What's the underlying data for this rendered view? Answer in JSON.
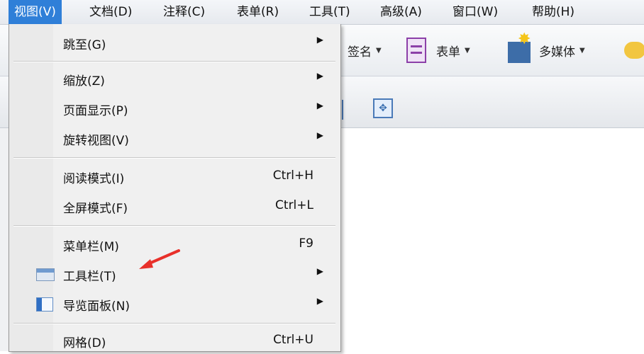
{
  "menubar": {
    "items": [
      "视图(V)",
      "文档(D)",
      "注释(C)",
      "表单(R)",
      "工具(T)",
      "高级(A)",
      "窗口(W)",
      "帮助(H)"
    ]
  },
  "toolbar": {
    "signature_label": "签名",
    "form_label": "表单",
    "multimedia_label": "多媒体"
  },
  "view_menu": {
    "goto": {
      "label": "跳至(G)"
    },
    "zoom": {
      "label": "缩放(Z)"
    },
    "page_display": {
      "label": "页面显示(P)"
    },
    "rotate": {
      "label": "旋转视图(V)"
    },
    "reading_mode": {
      "label": "阅读模式(I)",
      "shortcut": "Ctrl+H"
    },
    "fullscreen": {
      "label": "全屏模式(F)",
      "shortcut": "Ctrl+L"
    },
    "menubar": {
      "label": "菜单栏(M)",
      "shortcut": "F9"
    },
    "toolbars": {
      "label": "工具栏(T)"
    },
    "nav_panel": {
      "label": "导览面板(N)"
    },
    "grid": {
      "label": "网格(D)",
      "shortcut": "Ctrl+U"
    }
  },
  "colors": {
    "active_menu": "#2f7fd8",
    "annotation_arrow": "#e8302a"
  },
  "icons": {
    "form": "form-icon",
    "multimedia": "multimedia-icon",
    "toolbar": "toolbar-icon",
    "nav_panel": "nav-panel-icon"
  }
}
